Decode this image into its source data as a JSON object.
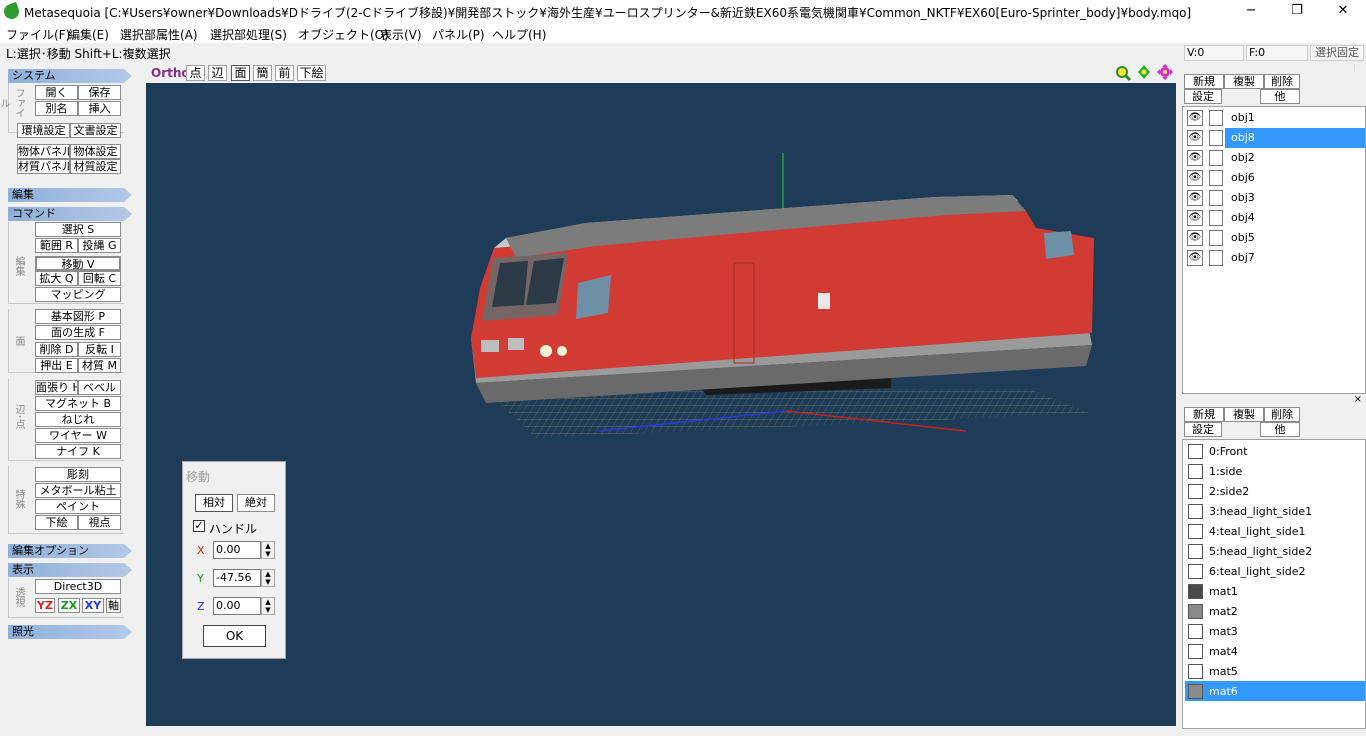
{
  "window": {
    "title": "Metasequoia [C:¥Users¥owner¥Downloads¥Dドライブ(2-Cドライブ移設)¥開発部ストック¥海外生産¥ユーロスプリンター&新近鉄EX60系電気機関車¥Common_NKTF¥EX60[Euro-Sprinter_body]¥body.mqo]",
    "minimize": "−",
    "maximize": "❐",
    "close": "✕"
  },
  "menu": [
    "ファイル(F)",
    "編集(E)",
    "選択部属性(A)",
    "選択部処理(S)",
    "オブジェクト(O)",
    "表示(V)",
    "パネル(P)",
    "ヘルプ(H)"
  ],
  "hint": "L:選択･移動 Shift+L:複数選択",
  "status": {
    "v": "V:0",
    "f": "F:0",
    "lock": "選択固定"
  },
  "left": {
    "system": "システム",
    "file_label": "ファイル",
    "open": "開く",
    "save": "保存",
    "saveas": "別名",
    "insert": "挿入",
    "env": "環境設定",
    "doc": "文書設定",
    "objpanel": "物体パネル",
    "objset": "物体設定",
    "matpanel": "材質パネル",
    "matset": "材質設定",
    "edit": "編集",
    "command": "コマンド",
    "edit_label": "編集",
    "select": "選択 S",
    "range": "範囲 R",
    "lasso": "投縄 G",
    "move": "移動 V",
    "scale": "拡大 Q",
    "rotate": "回転 C",
    "mapping": "マッピング",
    "face_label": "面",
    "basic": "基本図形 P",
    "genface": "面の生成 F",
    "delete": "削除 D",
    "invert": "反転 I",
    "extrude": "押出 E",
    "material": "材質 M",
    "edgept_label": "辺･点",
    "chamfer": "面張り H",
    "bevel": "ベベル",
    "magnet": "マグネット B",
    "twist": "ねじれ",
    "wire": "ワイヤー W",
    "knife": "ナイフ K",
    "special_label": "特殊",
    "sculpt": "彫刻",
    "metaball": "メタボール粘土",
    "paint": "ペイント",
    "underlay": "下絵",
    "viewpoint": "視点",
    "editopt": "編集オプション",
    "display": "表示",
    "persp_label": "透視",
    "d3d": "Direct3D",
    "yz": "YZ",
    "zx": "ZX",
    "xy": "XY",
    "axis": "軸",
    "light": "照光"
  },
  "viewbar": {
    "ortho": "Ortho",
    "point": "点",
    "edge": "辺",
    "face": "面",
    "simple": "簡",
    "front": "前",
    "under": "下絵"
  },
  "colors": {
    "viewport": "#1e3b57",
    "train_red": "#d23a34",
    "select_blue": "#3399ff"
  },
  "move_dialog": {
    "title": "移動",
    "relative": "相対",
    "absolute": "絶対",
    "handle": "ハンドル",
    "x_label": "X",
    "y_label": "Y",
    "z_label": "Z",
    "x": "0.00",
    "y": "-47.56",
    "z": "0.00",
    "ok": "OK"
  },
  "objects": {
    "new": "新規",
    "dup": "複製",
    "del": "削除",
    "settings": "設定",
    "other": "他",
    "items": [
      "obj1",
      "obj8",
      "obj2",
      "obj6",
      "obj3",
      "obj4",
      "obj5",
      "obj7"
    ],
    "selected": "obj8"
  },
  "materials": {
    "new": "新規",
    "dup": "複製",
    "del": "削除",
    "settings": "設定",
    "other": "他",
    "items": [
      "0:Front",
      "1:side",
      "2:side2",
      "3:head_light_side1",
      "4:teal_light_side1",
      "5:head_light_side2",
      "6:teal_light_side2",
      "mat1",
      "mat2",
      "mat3",
      "mat4",
      "mat5",
      "mat6"
    ],
    "swatches": [
      "#ffffff",
      "#ffffff",
      "#ffffff",
      "#ffffff",
      "#ffffff",
      "#ffffff",
      "#ffffff",
      "#4a4a4a",
      "#8a8a8a",
      "#ffffff",
      "#ffffff",
      "#ffffff",
      "#8a8a8a"
    ],
    "selected": "mat6"
  }
}
